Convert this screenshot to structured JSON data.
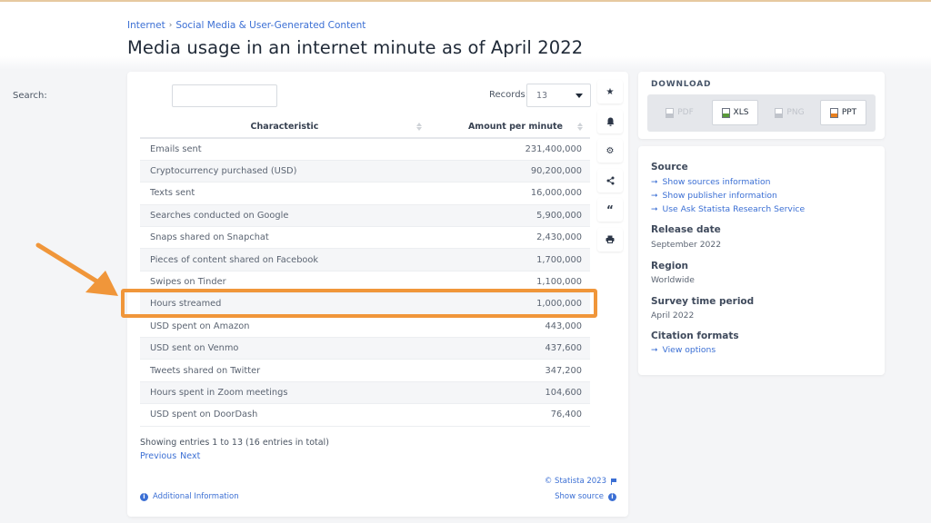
{
  "breadcrumb": {
    "items": [
      "Internet",
      "Social Media & User-Generated Content"
    ],
    "separator": "›"
  },
  "page_title": "Media usage in an internet minute as of April 2022",
  "table_controls": {
    "search_label": "Search:",
    "search_value": "",
    "records_label": "Records:",
    "records_value": "13"
  },
  "table": {
    "columns": [
      "Characteristic",
      "Amount per minute"
    ],
    "rows": [
      {
        "characteristic": "Emails sent",
        "amount": "231,400,000"
      },
      {
        "characteristic": "Cryptocurrency purchased (USD)",
        "amount": "90,200,000"
      },
      {
        "characteristic": "Texts sent",
        "amount": "16,000,000"
      },
      {
        "characteristic": "Searches conducted on Google",
        "amount": "5,900,000"
      },
      {
        "characteristic": "Snaps shared on Snapchat",
        "amount": "2,430,000"
      },
      {
        "characteristic": "Pieces of content shared on Facebook",
        "amount": "1,700,000"
      },
      {
        "characteristic": "Swipes on Tinder",
        "amount": "1,100,000"
      },
      {
        "characteristic": "Hours streamed",
        "amount": "1,000,000"
      },
      {
        "characteristic": "USD spent on Amazon",
        "amount": "443,000"
      },
      {
        "characteristic": "USD sent on Venmo",
        "amount": "437,600"
      },
      {
        "characteristic": "Tweets shared on Twitter",
        "amount": "347,200"
      },
      {
        "characteristic": "Hours spent in Zoom meetings",
        "amount": "104,600"
      },
      {
        "characteristic": "USD spent on DoorDash",
        "amount": "76,400"
      }
    ],
    "highlighted_row": "Hours streamed"
  },
  "footer": {
    "entries_info": "Showing entries 1 to 13 (16 entries in total)",
    "previous": "Previous",
    "next": "Next",
    "copyright": "© Statista 2023",
    "show_source": "Show source",
    "additional_info": "Additional Information"
  },
  "side_tools": [
    {
      "icon": "star-icon",
      "glyph": "★"
    },
    {
      "icon": "bell-icon",
      "glyph": "🔔"
    },
    {
      "icon": "gear-icon",
      "glyph": "⚙"
    },
    {
      "icon": "share-icon",
      "glyph": "<"
    },
    {
      "icon": "quote-icon",
      "glyph": "“"
    },
    {
      "icon": "print-icon",
      "glyph": "⎙"
    }
  ],
  "download": {
    "title": "DOWNLOAD",
    "buttons": [
      {
        "label": "PDF",
        "enabled": false
      },
      {
        "label": "XLS",
        "enabled": true,
        "color": "#5a9a3a"
      },
      {
        "label": "PNG",
        "enabled": false
      },
      {
        "label": "PPT",
        "enabled": true,
        "color": "#e8801f"
      }
    ]
  },
  "info": {
    "source_heading": "Source",
    "source_links": [
      "Show sources information",
      "Show publisher information",
      "Use Ask Statista Research Service"
    ],
    "release_heading": "Release date",
    "release_value": "September 2022",
    "region_heading": "Region",
    "region_value": "Worldwide",
    "survey_heading": "Survey time period",
    "survey_value": "April 2022",
    "citation_heading": "Citation formats",
    "citation_link": "View options"
  },
  "colors": {
    "link": "#3b6fd4",
    "highlight": "#f0963a"
  }
}
